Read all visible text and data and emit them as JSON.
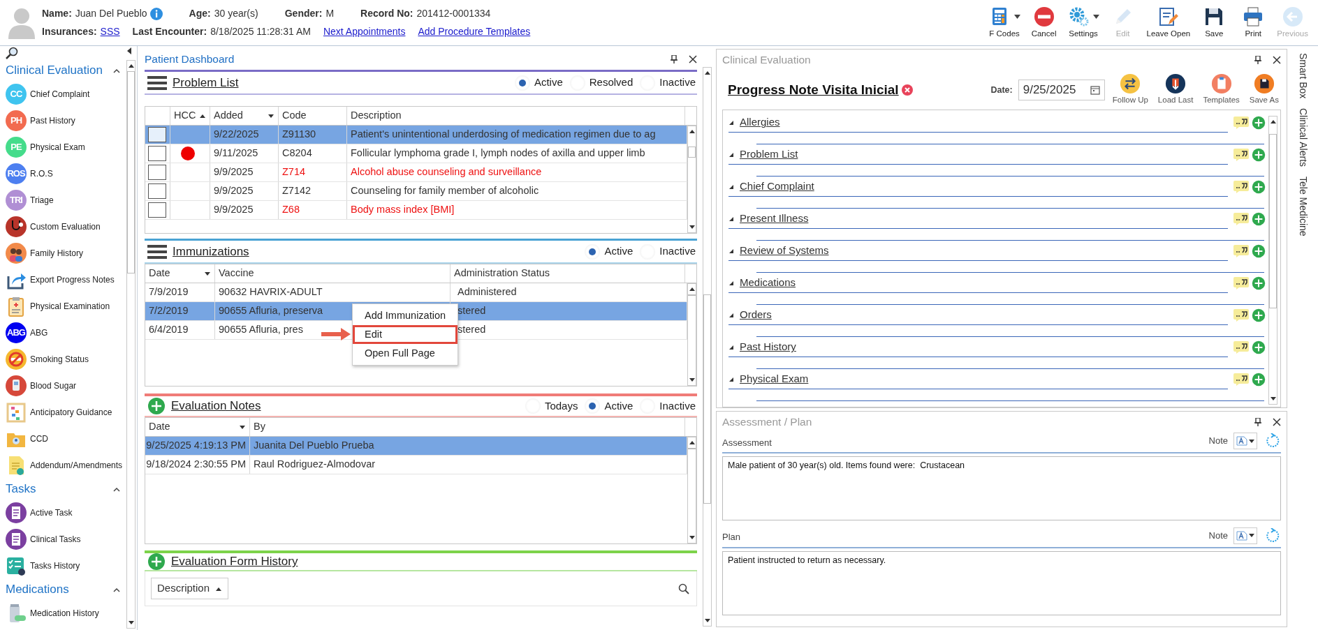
{
  "header": {
    "line1": [
      {
        "label": "Name:",
        "value": "Juan Del Pueblo",
        "info": true
      },
      {
        "label": "Age:",
        "value": "30 year(s)"
      },
      {
        "label": "Gender:",
        "value": "M"
      },
      {
        "label": "Record No:",
        "value": "201412-0001334"
      }
    ],
    "line2": [
      {
        "kind": "field",
        "label": "Insurances:",
        "value": "SSS",
        "link": true
      },
      {
        "kind": "field",
        "label": "Last Encounter:",
        "value": "8/18/2025 11:28:31 AM",
        "link": false
      },
      {
        "kind": "link",
        "text": "Next Appointments"
      },
      {
        "kind": "link",
        "text": "Add Procedure Templates"
      }
    ]
  },
  "toolbar": [
    {
      "label": "F Codes",
      "kind": "calculator",
      "dropdown": true,
      "disabled": false
    },
    {
      "label": "Cancel",
      "kind": "cancel",
      "dropdown": false,
      "disabled": false
    },
    {
      "label": "Settings",
      "kind": "gears",
      "dropdown": true,
      "disabled": false
    },
    {
      "label": "Edit",
      "kind": "pencil",
      "dropdown": false,
      "disabled": true
    },
    {
      "label": "Leave Open",
      "kind": "notepad",
      "dropdown": false,
      "disabled": false
    },
    {
      "label": "Save",
      "kind": "floppy",
      "dropdown": false,
      "disabled": false
    },
    {
      "label": "Print",
      "kind": "printer",
      "dropdown": false,
      "disabled": false
    },
    {
      "label": "Previous",
      "kind": "back",
      "dropdown": false,
      "disabled": true
    }
  ],
  "sidebar": {
    "groups": [
      {
        "title": "Clinical Evaluation",
        "expanded": true,
        "items": [
          {
            "label": "Chief Complaint",
            "kind": "letters",
            "badge": "CC",
            "color": "#3fc4ef"
          },
          {
            "label": "Past History",
            "kind": "letters",
            "badge": "PH",
            "color": "#f26b50"
          },
          {
            "label": "Physical Exam",
            "kind": "letters",
            "badge": "PE",
            "color": "#45dc8b"
          },
          {
            "label": "R.O.S",
            "kind": "letters",
            "badge": "ROS",
            "color": "#4d7ff0"
          },
          {
            "label": "Triage",
            "kind": "letters",
            "badge": "TRI",
            "color": "#b08fd4"
          },
          {
            "label": "Custom Evaluation",
            "kind": "stethoscope"
          },
          {
            "label": "Family History",
            "kind": "family"
          },
          {
            "label": "Export Progress Notes",
            "kind": "export"
          },
          {
            "label": "Physical Examination",
            "kind": "clipboard"
          },
          {
            "label": "ABG",
            "kind": "letters",
            "badge": "ABG",
            "color": "#0000f0"
          },
          {
            "label": "Smoking Status",
            "kind": "smoking"
          },
          {
            "label": "Blood Sugar",
            "kind": "glucometer"
          },
          {
            "label": "Anticipatory Guidance",
            "kind": "abacus"
          },
          {
            "label": "CCD",
            "kind": "folder"
          },
          {
            "label": "Addendum/Amendments",
            "kind": "document"
          }
        ]
      },
      {
        "title": "Tasks",
        "expanded": true,
        "items": [
          {
            "label": "Active Task",
            "kind": "task"
          },
          {
            "label": "Clinical Tasks",
            "kind": "task"
          },
          {
            "label": "Tasks History",
            "kind": "checklist"
          }
        ]
      },
      {
        "title": "Medications",
        "expanded": true,
        "items": [
          {
            "label": "Medication History",
            "kind": "medication"
          }
        ]
      }
    ]
  },
  "dashboard": {
    "title": "Patient Dashboard",
    "problem_list": {
      "title": "Problem List",
      "filters": [
        {
          "label": "Active",
          "selected": true
        },
        {
          "label": "Resolved",
          "selected": false
        },
        {
          "label": "Inactive",
          "selected": false
        }
      ],
      "columns": [
        {
          "label": "HCC",
          "kind": "sorted"
        },
        {
          "label": "Added",
          "kind": "menu"
        },
        {
          "label": "Code",
          "kind": "plain"
        },
        {
          "label": "Description",
          "kind": "plain"
        }
      ],
      "rows": [
        {
          "selected": true,
          "checked": false,
          "hcc": false,
          "added": "9/22/2025",
          "code": "Z91130",
          "description": "Patient's unintentional underdosing of medication regimen due to ag",
          "alert": false
        },
        {
          "selected": false,
          "checked": false,
          "hcc": true,
          "added": "9/11/2025",
          "code": "C8204",
          "description": "Follicular lymphoma grade I, lymph nodes of axilla and upper limb",
          "alert": false
        },
        {
          "selected": false,
          "checked": false,
          "hcc": false,
          "added": "9/9/2025",
          "code": "Z714",
          "description": "Alcohol abuse counseling and surveillance",
          "alert": true
        },
        {
          "selected": false,
          "checked": false,
          "hcc": false,
          "added": "9/9/2025",
          "code": "Z7142",
          "description": "Counseling for family member of alcoholic",
          "alert": false
        },
        {
          "selected": false,
          "checked": false,
          "hcc": false,
          "added": "9/9/2025",
          "code": "Z68",
          "description": "Body mass index [BMI]",
          "alert": true
        }
      ]
    },
    "immunizations": {
      "title": "Immunizations",
      "filters": [
        {
          "label": "Active",
          "selected": true
        },
        {
          "label": "Inactive",
          "selected": false
        }
      ],
      "columns": [
        {
          "label": "Date",
          "kind": "menu"
        },
        {
          "label": "Vaccine",
          "kind": "plain"
        },
        {
          "label": "Administration Status",
          "kind": "plain"
        }
      ],
      "rows": [
        {
          "selected": false,
          "date": "7/9/2019",
          "vaccine": "90632 HAVRIX-ADULT",
          "status": "Administered"
        },
        {
          "selected": true,
          "date": "7/2/2019",
          "vaccine": "90655 Afluria, preserva",
          "status": "stered"
        },
        {
          "selected": false,
          "date": "6/4/2019",
          "vaccine": "90655 Afluria, pres",
          "status": "stered"
        }
      ],
      "context_menu": [
        {
          "label": "Add Immunization",
          "highlighted": false
        },
        {
          "label": "Edit",
          "highlighted": true
        },
        {
          "label": "Open Full Page",
          "highlighted": false
        }
      ]
    },
    "evaluation_notes": {
      "title": "Evaluation Notes",
      "filters": [
        {
          "label": "Todays",
          "selected": false
        },
        {
          "label": "Active",
          "selected": true
        },
        {
          "label": "Inactive",
          "selected": false
        }
      ],
      "columns": [
        {
          "label": "Date",
          "kind": "menu"
        },
        {
          "label": "By",
          "kind": "plain"
        }
      ],
      "rows": [
        {
          "selected": true,
          "date": "9/25/2025 4:19:13 PM",
          "by": "Juanita Del Pueblo Prueba"
        },
        {
          "selected": false,
          "date": "9/18/2024 2:30:55 PM",
          "by": "Raul Rodriguez-Almodovar"
        }
      ]
    },
    "form_history": {
      "title": "Evaluation Form History",
      "sort_label": "Description"
    }
  },
  "clinical_evaluation": {
    "title": "Clinical Evaluation",
    "note_title": "Progress Note Visita Inicial",
    "date_label": "Date:",
    "date": "9/25/2025",
    "actions": [
      {
        "label": "Follow Up",
        "kind": "swap"
      },
      {
        "label": "Load Last",
        "kind": "download"
      },
      {
        "label": "Templates",
        "kind": "clipboard"
      },
      {
        "label": "Save As",
        "kind": "floppy"
      }
    ],
    "sections": [
      {
        "label": "Allergies",
        "expanded": true
      },
      {
        "label": "Problem List",
        "expanded": true
      },
      {
        "label": "Chief Complaint",
        "expanded": true
      },
      {
        "label": "Present Illness",
        "expanded": true
      },
      {
        "label": "Review of Systems",
        "expanded": true
      },
      {
        "label": "Medications",
        "expanded": true
      },
      {
        "label": "Orders",
        "expanded": true
      },
      {
        "label": "Past History",
        "expanded": true
      },
      {
        "label": "Physical Exam",
        "expanded": true
      }
    ]
  },
  "assessment_plan": {
    "title": "Assessment / Plan",
    "fields": [
      {
        "label": "Assessment",
        "note_label": "Note",
        "text": "Male patient of 30 year(s) old. Items found were:  Crustacean"
      },
      {
        "label": "Plan",
        "note_label": "Note",
        "text": "Patient instructed to return as necessary."
      }
    ]
  },
  "side_tabs": [
    "Smart Box",
    "Clinical Alerts",
    "Tele Medicine"
  ]
}
